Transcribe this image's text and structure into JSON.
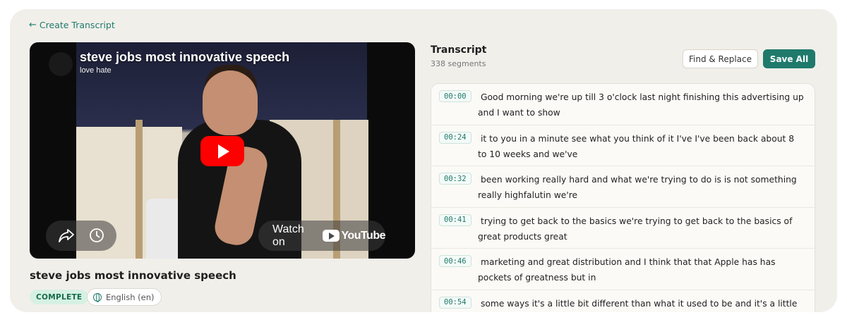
{
  "nav": {
    "back_label": "Create Transcript"
  },
  "video": {
    "title": "steve jobs most innovative speech",
    "subtitle": "love hate",
    "watch_label": "Watch on",
    "platform": "YouTube",
    "caption": "steve jobs most innovative speech"
  },
  "meta": {
    "status": "COMPLETE",
    "language": "English (en)"
  },
  "transcript": {
    "title": "Transcript",
    "count": "338 segments",
    "find_replace_label": "Find & Replace",
    "save_label": "Save All",
    "segments": [
      {
        "time": "00:00",
        "text": "Good morning we're up till 3 o'clock last night finishing this advertising up and I want to show"
      },
      {
        "time": "00:24",
        "text": "it to you in a minute see what you think of it I've I've been back about 8 to 10 weeks and we've"
      },
      {
        "time": "00:32",
        "text": "been working really hard and what we're trying to do is is not something really highfalutin we're"
      },
      {
        "time": "00:41",
        "text": "trying to get back to the basics we're trying to get back to the basics of great products great"
      },
      {
        "time": "00:46",
        "text": "marketing and great distribution and I think that that Apple has has pockets of greatness but in"
      },
      {
        "time": "00:54",
        "text": "some ways it's a little bit different than what it used to be and it's a little bit different"
      }
    ]
  },
  "colors": {
    "accent": "#1f7a6c",
    "badge_bg": "#d6f1e4",
    "youtube_red": "#ff0000"
  },
  "icons": [
    "arrow-left-icon",
    "share-icon",
    "clock-icon",
    "play-icon",
    "youtube-logo-icon",
    "globe-icon"
  ]
}
